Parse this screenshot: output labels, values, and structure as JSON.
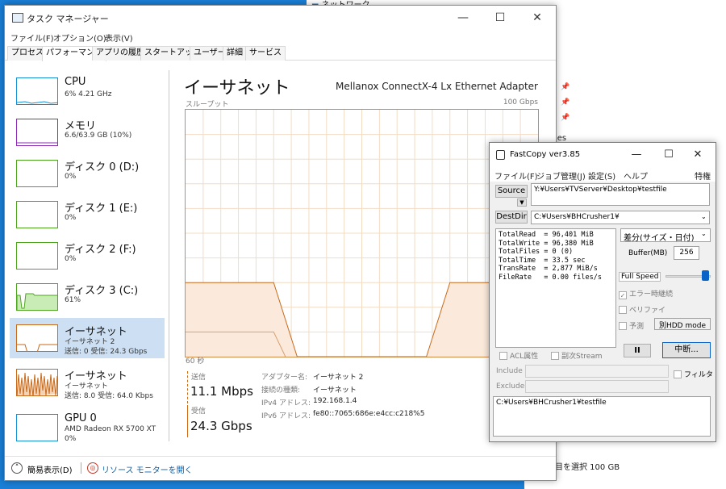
{
  "explorer": {
    "network_label": "ネットワーク",
    "frag": "les",
    "status": "目を選択  100 GB"
  },
  "taskmanager": {
    "title": "タスク マネージャー",
    "menu": [
      "ファイル(F)",
      "オプション(O)",
      "表示(V)"
    ],
    "tabs": [
      "プロセス",
      "パフォーマンス",
      "アプリの履歴",
      "スタートアップ",
      "ユーザー",
      "詳細",
      "サービス"
    ],
    "sidebar": [
      {
        "name": "CPU",
        "l1": "6%  4.21 GHz",
        "l2": ""
      },
      {
        "name": "メモリ",
        "l1": "6.6/63.9 GB (10%)",
        "l2": ""
      },
      {
        "name": "ディスク 0 (D:)",
        "l1": "0%",
        "l2": ""
      },
      {
        "name": "ディスク 1 (E:)",
        "l1": "0%",
        "l2": ""
      },
      {
        "name": "ディスク 2 (F:)",
        "l1": "0%",
        "l2": ""
      },
      {
        "name": "ディスク 3 (C:)",
        "l1": "61%",
        "l2": ""
      },
      {
        "name": "イーサネット",
        "l1": "イーサネット 2",
        "l2": "送信: 0 受信: 24.3 Gbps"
      },
      {
        "name": "イーサネット",
        "l1": "イーサネット",
        "l2": "送信: 8.0 受信: 64.0 Kbps"
      },
      {
        "name": "GPU 0",
        "l1": "AMD Radeon RX 5700 XT",
        "l2": "0%"
      }
    ],
    "main": {
      "title": "イーサネット",
      "adapter": "Mellanox ConnectX-4 Lx Ethernet Adapter",
      "throughput_label": "スループット",
      "max_label": "100 Gbps",
      "time_label": "60 秒",
      "send_label": "送信",
      "send_value": "11.1 Mbps",
      "recv_label": "受信",
      "recv_value": "24.3 Gbps",
      "info": [
        {
          "k": "アダプター名:",
          "v": "イーサネット 2"
        },
        {
          "k": "接続の種類:",
          "v": "イーサネット"
        },
        {
          "k": "IPv4 アドレス:",
          "v": "192.168.1.4"
        },
        {
          "k": "IPv6 アドレス:",
          "v": "fe80::7065:686e:e4cc:c218%5"
        }
      ]
    },
    "footer": {
      "less": "簡易表示(D)",
      "resmon": "リソース モニターを開く"
    }
  },
  "fastcopy": {
    "title": "FastCopy ver3.85",
    "menu": [
      "ファイル(F)",
      "ジョブ管理(J)",
      "設定(S)",
      "ヘルプ",
      "特権"
    ],
    "source_btn": "Source",
    "source_path": "Y:¥Users¥TVServer¥Desktop¥testfile",
    "destdir_btn": "DestDir",
    "dest_path": "C:¥Users¥BHCrusher1¥",
    "log": "TotalRead  = 96,401 MiB\nTotalWrite = 96,380 MiB\nTotalFiles = 0 (0)\nTotalTime  = 33.5 sec\nTransRate  = 2,877 MiB/s\nFileRate   = 0.00 files/s",
    "mode": "差分(サイズ・日付)",
    "buffer_label": "Buffer(MB)",
    "buffer_value": "256",
    "speed_label": "Full Speed",
    "opt_error": "エラー時継続",
    "opt_verify": "ベリファイ",
    "opt_estimate": "予測",
    "hdd_mode": "別HDD mode",
    "acl": "ACL属性",
    "stream": "副次Stream",
    "pause_btn": "II",
    "stop_btn": "中断...",
    "include_label": "Include",
    "exclude_label": "Exclude",
    "filter_label": "フィルタ",
    "status_path": "C:¥Users¥BHCrusher1¥testfile"
  },
  "graph_series": {
    "x": [
      0,
      1,
      10,
      15,
      19,
      41,
      45,
      60
    ],
    "y": [
      30,
      30,
      30,
      30,
      0,
      0,
      30,
      30
    ]
  }
}
